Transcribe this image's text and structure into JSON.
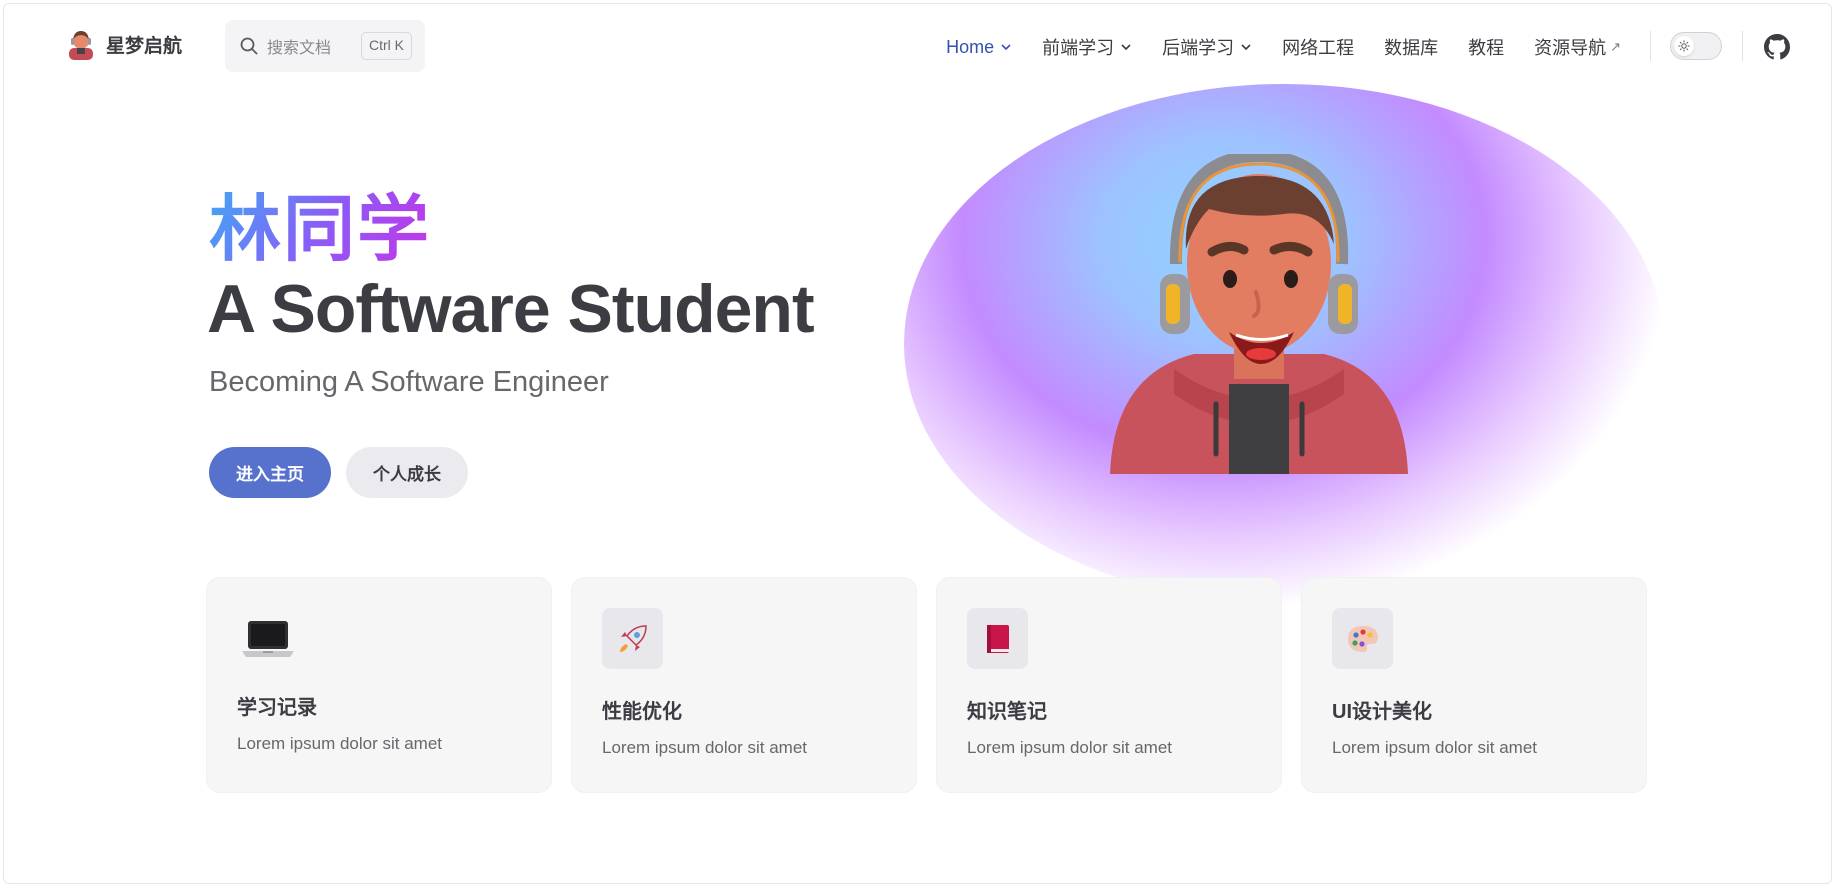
{
  "nav": {
    "brand_title": "星梦启航",
    "search_placeholder": "搜索文档",
    "search_shortcut": "Ctrl K",
    "items": [
      {
        "label": "Home",
        "dropdown": true,
        "active": true
      },
      {
        "label": "前端学习",
        "dropdown": true
      },
      {
        "label": "后端学习",
        "dropdown": true
      },
      {
        "label": "网络工程"
      },
      {
        "label": "数据库"
      },
      {
        "label": "教程"
      },
      {
        "label": "资源导航",
        "external": true
      }
    ],
    "external_mark": "↗",
    "icons": [
      "search-icon",
      "chevron-down-icon",
      "sun-icon",
      "github-icon"
    ]
  },
  "hero": {
    "name": "林同学",
    "text": "A Software Student",
    "tagline": "Becoming A Software Engineer",
    "actions": [
      "进入主页",
      "个人成长"
    ]
  },
  "features": [
    {
      "icon": "laptop-icon",
      "title": "学习记录",
      "details": "Lorem ipsum dolor sit amet"
    },
    {
      "icon": "rocket-icon",
      "title": "性能优化",
      "details": "Lorem ipsum dolor sit amet"
    },
    {
      "icon": "book-icon",
      "title": "知识笔记",
      "details": "Lorem ipsum dolor sit amet"
    },
    {
      "icon": "palette-icon",
      "title": "UI设计美化",
      "details": "Lorem ipsum dolor sit amet"
    }
  ],
  "colors": {
    "brand": "#3451b2",
    "primary_button": "#5672cd",
    "name_gradient": [
      "#41a7f5",
      "#8a5cf6",
      "#c932e8"
    ]
  }
}
